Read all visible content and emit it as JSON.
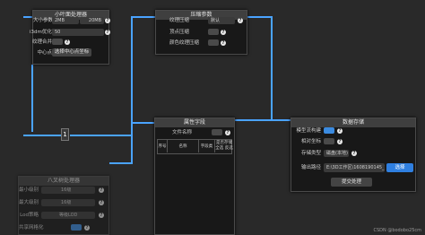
{
  "colors": {
    "wire": "#4aa3ff",
    "toggle_on": "#3b8be0",
    "node_bg": "#181818",
    "title_bg": "#3f3f3f"
  },
  "small_leaf": {
    "title": "小叶面处理器",
    "size_label": "大小参数",
    "size_min": "2MB",
    "size_max": "20MB",
    "i3dm_label": "i3dm优化数",
    "i3dm_value": "50",
    "merge_label": "纹理合并",
    "center_label": "中心点",
    "center_button": "选择中心点坐标"
  },
  "compress": {
    "title": "压缩参数",
    "texture_label": "纹理压缩",
    "texture_value": "默认",
    "vertex_label": "顶点压缩",
    "color_label": "颜色纹理压缩"
  },
  "reroute": {
    "label": "1"
  },
  "attribute": {
    "title": "属性字段",
    "file_label": "文件名称",
    "columns": [
      "序号",
      "名称",
      "字段类型",
      "是否存储"
    ],
    "select_all": "全选",
    "invert": "反选"
  },
  "storage": {
    "title": "数据存储",
    "stream_label": "模型流构建",
    "relative_label": "相对坐标",
    "storage_type_label": "存储类型",
    "storage_type_value": "磁盘(本地)",
    "output_label": "输出路径",
    "output_path": "E:\\3D工作区\\1608190145_2",
    "choose_button": "选择",
    "submit_button": "提交处理"
  },
  "octree": {
    "title": "八叉树处理器",
    "min_level_label": "最小级别",
    "min_level_value": "16级",
    "max_level_label": "最大级别",
    "max_level_value": "16级",
    "lod_label": "Lod策略",
    "lod_value": "等级LOD",
    "share_label": "共享网格化"
  },
  "watermark": "CSDN @bodobo25cm"
}
